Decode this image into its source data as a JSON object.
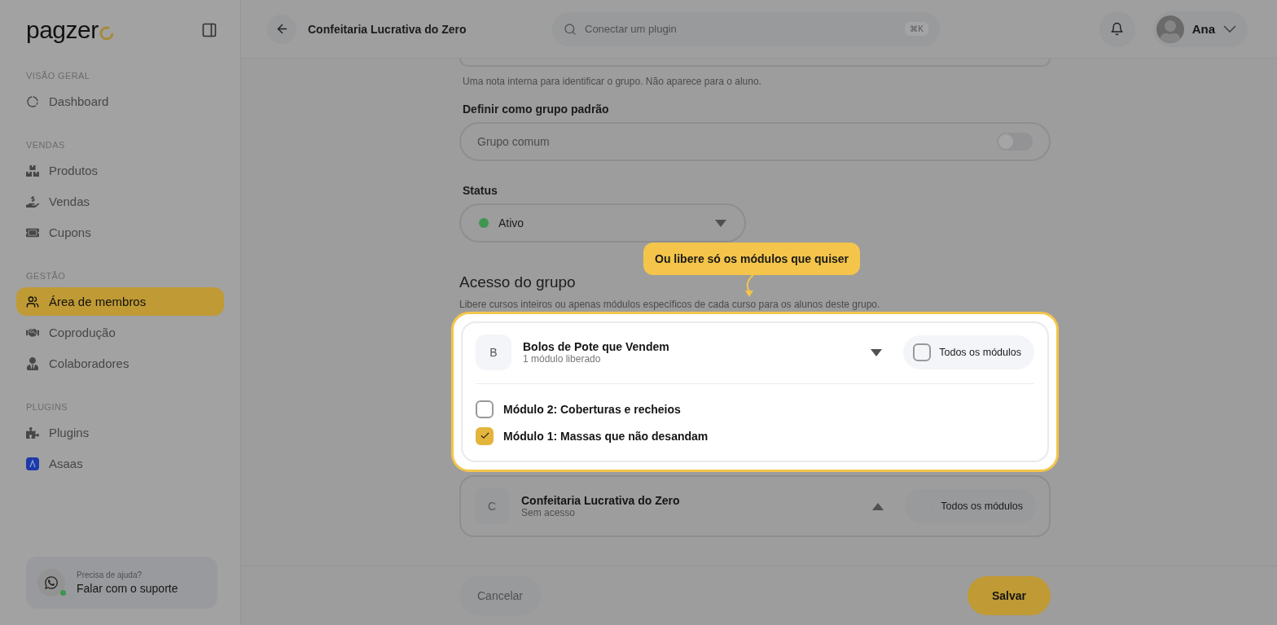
{
  "sidebar": {
    "logo": "pagzer",
    "sections": [
      {
        "title": "VISÃO GERAL",
        "items": [
          {
            "label": "Dashboard",
            "selected": false
          }
        ]
      },
      {
        "title": "VENDAS",
        "items": [
          {
            "label": "Produtos",
            "selected": false
          },
          {
            "label": "Vendas",
            "selected": false
          },
          {
            "label": "Cupons",
            "selected": false
          }
        ]
      },
      {
        "title": "GESTÃO",
        "items": [
          {
            "label": "Área de membros",
            "selected": true
          },
          {
            "label": "Coprodução",
            "selected": false
          },
          {
            "label": "Colaboradores",
            "selected": false
          }
        ]
      },
      {
        "title": "PLUGINS",
        "items": [
          {
            "label": "Plugins",
            "selected": false
          },
          {
            "label": "Asaas",
            "selected": false
          }
        ]
      }
    ],
    "help": {
      "caption": "Precisa de ajuda?",
      "link": "Falar com o suporte"
    }
  },
  "header": {
    "title": "Confeitaria Lucrativa do Zero",
    "search": {
      "placeholder": "Conectar um plugin",
      "shortcut": "⌘K"
    },
    "user": "Ana"
  },
  "form": {
    "description_hint": "Uma nota interna para identificar o grupo. Não aparece para o aluno.",
    "default_label": "Definir como grupo padrão",
    "default_text": "Grupo comum",
    "default_on": false,
    "status_label": "Status",
    "status_value": "Ativo"
  },
  "access": {
    "title": "Acesso do grupo",
    "subtitle": "Libere cursos inteiros ou apenas módulos específicos de cada curso para os alunos deste grupo.",
    "courses": [
      {
        "initial": "B",
        "title": "Bolos de Pote que Vendem",
        "subtitle": "1 módulo liberado",
        "expanded": true,
        "highlighted": true,
        "all_label": "Todos os módulos",
        "all_checked": false,
        "modules": [
          {
            "label": "Módulo 2: Coberturas e recheios",
            "checked": false
          },
          {
            "label": "Módulo 1: Massas que não desandam",
            "checked": true
          }
        ]
      },
      {
        "initial": "C",
        "title": "Confeitaria Lucrativa do Zero",
        "subtitle": "Sem acesso",
        "expanded": false,
        "highlighted": false,
        "all_label": "Todos os módulos",
        "all_checked": false
      }
    ]
  },
  "tooltip": "Ou libere só os módulos que quiser",
  "footer": {
    "cancel": "Cancelar",
    "save": "Salvar"
  }
}
